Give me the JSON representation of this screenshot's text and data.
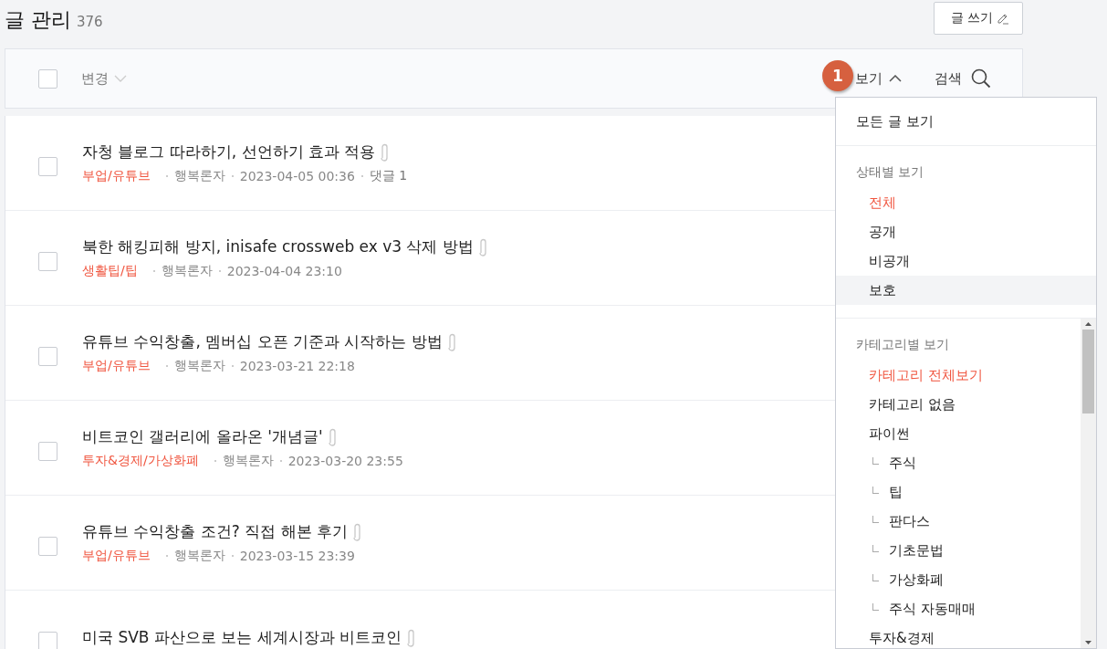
{
  "page": {
    "title": "글 관리",
    "count": "376",
    "write_button": "글 쓰기"
  },
  "toolbar": {
    "select_all_checked": false,
    "change": "변경",
    "view": "보기",
    "view_expanded": true,
    "search": "검색",
    "annotation_badge": "1"
  },
  "posts": [
    {
      "title": "자청 블로그 따라하기, 선언하기 효과 적용",
      "category": "부업/유튜브",
      "author": "행복론자",
      "date": "2023-04-05 00:36",
      "comments": "댓글 1",
      "checked": false
    },
    {
      "title": "북한 해킹피해 방지, inisafe crossweb ex v3 삭제 방법",
      "category": "생활팁/팁",
      "author": "행복론자",
      "date": "2023-04-04 23:10",
      "checked": false
    },
    {
      "title": "유튜브 수익창출, 멤버십 오픈 기준과 시작하는 방법",
      "category": "부업/유튜브",
      "author": "행복론자",
      "date": "2023-03-21 22:18",
      "checked": false
    },
    {
      "title": "비트코인 갤러리에 올라온 '개념글'",
      "category": "투자&경제/가상화폐",
      "author": "행복론자",
      "date": "2023-03-20 23:55",
      "checked": false
    },
    {
      "title": "유튜브 수익창출 조건? 직접 해본 후기",
      "category": "부업/유튜브",
      "author": "행복론자",
      "date": "2023-03-15 23:39",
      "checked": false
    },
    {
      "title": "미국 SVB 파산으로 보는 세계시장과 비트코인",
      "checked": false
    }
  ],
  "view_menu": {
    "all_posts": "모든 글 보기",
    "status_heading": "상태별 보기",
    "status_items": [
      {
        "label": "전체",
        "selected": true,
        "hovered": false
      },
      {
        "label": "공개",
        "selected": false,
        "hovered": false
      },
      {
        "label": "비공개",
        "selected": false,
        "hovered": false
      },
      {
        "label": "보호",
        "selected": false,
        "hovered": true
      }
    ],
    "category_heading": "카테고리별 보기",
    "category_items": [
      {
        "label": "카테고리 전체보기",
        "selected": true
      },
      {
        "label": "카테고리 없음",
        "selected": false
      },
      {
        "label": "파이썬",
        "selected": false,
        "children": [
          {
            "label": "주식",
            "selected": false
          },
          {
            "label": "팁",
            "selected": false
          },
          {
            "label": "판다스",
            "selected": false
          },
          {
            "label": "기초문법",
            "selected": false
          },
          {
            "label": "가상화폐",
            "selected": false
          },
          {
            "label": "주식 자동매매",
            "selected": false
          }
        ]
      },
      {
        "label": "투자&경제",
        "selected": false
      }
    ]
  }
}
